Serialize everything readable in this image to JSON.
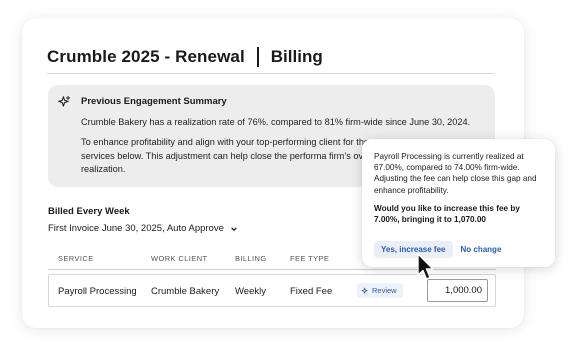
{
  "header": {
    "title": "Crumble 2025 - Renewal",
    "section": "Billing"
  },
  "summary": {
    "icon": "sparkle-icon",
    "title": "Previous Engagement Summary",
    "line1": "Crumble Bakery has a realization rate of 76%. compared to 81% firm-wide since June 30, 2024.",
    "paragraph": "To enhance profitability and align with your top-performing client for the services below. This adjustment can help close the performa firm’s overall realization."
  },
  "billing": {
    "frequency_title": "Billed Every Week",
    "invoice_label": "First Invoice June 30, 2025, Auto Approve"
  },
  "table": {
    "columns": [
      "SERVICE",
      "WORK CLIENT",
      "BILLING",
      "FEE TYPE"
    ],
    "rows": [
      {
        "service": "Payroll Processing",
        "work_client": "Crumble Bakery",
        "billing": "Weekly",
        "fee_type": "Fixed Fee",
        "review_label": "Review",
        "fee": "1,000.00"
      }
    ]
  },
  "popover": {
    "text": "Payroll Processing is currently realized at 67.00%, compared to 74.00% firm-wide. Adjusting the fee can help close this gap and enhance profitability.",
    "question": "Would you like to increase this fee by 7.00%, bringing it to 1,070.00",
    "confirm_label": "Yes, increase fee",
    "decline_label": "No change"
  },
  "colors": {
    "accent": "#2a5db0",
    "summary_bg": "#ededed",
    "chip_bg": "#eef3fb"
  }
}
